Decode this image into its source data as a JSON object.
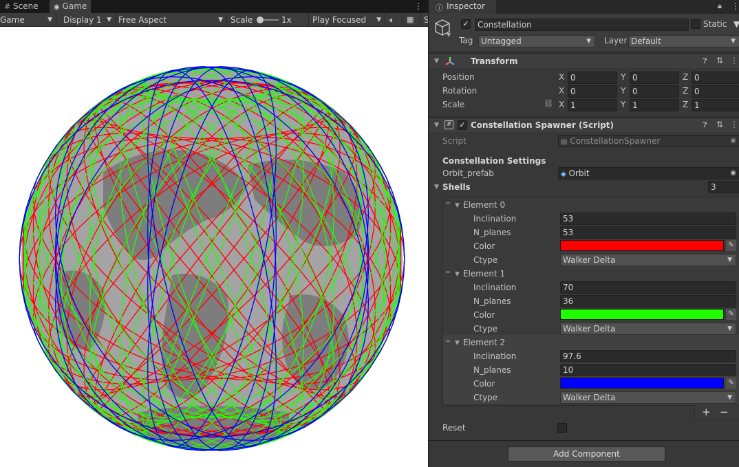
{
  "tabs": {
    "scene": "Scene",
    "game": "Game"
  },
  "game_toolbar": {
    "view_mode": "Game",
    "display": "Display 1",
    "aspect": "Free Aspect",
    "scale_label": "Scale",
    "scale_value": "1x",
    "play_mode": "Play Focused"
  },
  "inspector": {
    "tab_label": "Inspector",
    "object_name": "Constellation",
    "static_label": "Static",
    "tag_label": "Tag",
    "tag_value": "Untagged",
    "layer_label": "Layer",
    "layer_value": "Default",
    "transform": {
      "title": "Transform",
      "rows": [
        {
          "label": "Position",
          "x": "0",
          "y": "0",
          "z": "0"
        },
        {
          "label": "Rotation",
          "x": "0",
          "y": "0",
          "z": "0"
        },
        {
          "label": "Scale",
          "x": "1",
          "y": "1",
          "z": "1"
        }
      ],
      "axis_x": "X",
      "axis_y": "Y",
      "axis_z": "Z"
    },
    "spawner": {
      "title": "Constellation Spawner (Script)",
      "script_label": "Script",
      "script_value": "ConstellationSpawner",
      "settings_header": "Constellation Settings",
      "orbit_prefab_label": "Orbit_prefab",
      "orbit_prefab_value": "Orbit",
      "shells_label": "Shells",
      "shells_count": "3",
      "elements": [
        {
          "title": "Element 0",
          "inclination_label": "Inclination",
          "inclination": "53",
          "n_planes_label": "N_planes",
          "n_planes": "53",
          "color_label": "Color",
          "color": "#ff0000",
          "ctype_label": "Ctype",
          "ctype": "Walker Delta"
        },
        {
          "title": "Element 1",
          "inclination_label": "Inclination",
          "inclination": "70",
          "n_planes_label": "N_planes",
          "n_planes": "36",
          "color_label": "Color",
          "color": "#1eff00",
          "ctype_label": "Ctype",
          "ctype": "Walker Delta"
        },
        {
          "title": "Element 2",
          "inclination_label": "Inclination",
          "inclination": "97.6",
          "n_planes_label": "N_planes",
          "n_planes": "10",
          "color_label": "Color",
          "color": "#0000ff",
          "ctype_label": "Ctype",
          "ctype": "Walker Delta"
        }
      ],
      "add_label": "+",
      "remove_label": "−",
      "reset_label": "Reset"
    },
    "add_component": "Add Component"
  }
}
